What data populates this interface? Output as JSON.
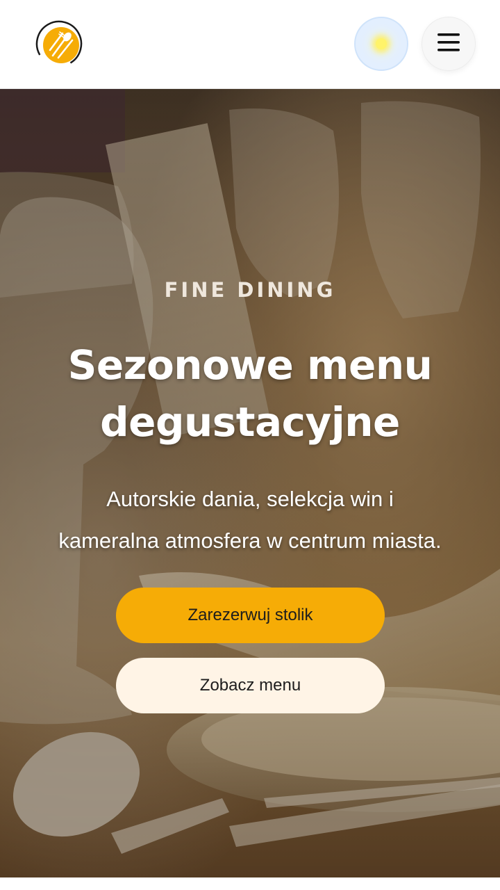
{
  "header": {
    "logo_icon": "fork-spoon-knife-logo",
    "theme_toggle_icon": "sun-icon",
    "menu_icon": "hamburger-menu-icon",
    "colors": {
      "logo_accent": "#f6ac06",
      "theme_toggle_bg": "#e3efff"
    }
  },
  "hero": {
    "eyebrow": "FINE DINING",
    "headline_line1": "Sezonowe menu",
    "headline_line2": "degustacyjne",
    "subtitle_line1": "Autorskie dania, selekcja win i",
    "subtitle_line2": "kameralna atmosfera w centrum miasta.",
    "primary_button": "Zarezerwuj stolik",
    "secondary_button": "Zobacz menu",
    "colors": {
      "primary": "#f6ac06",
      "secondary": "#fff4e6"
    }
  }
}
